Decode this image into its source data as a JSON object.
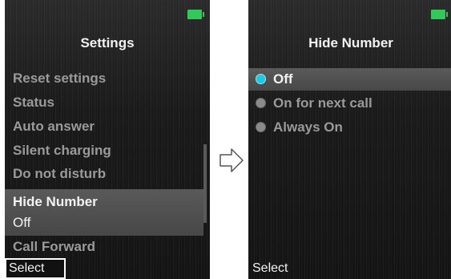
{
  "left_screen": {
    "title": "Settings",
    "menu_items": [
      "Reset settings",
      "Status",
      "Auto answer",
      "Silent charging",
      "Do not disturb",
      "Call Forward"
    ],
    "selected_item": {
      "label": "Hide Number",
      "value": "Off"
    },
    "softkey": "Select"
  },
  "right_screen": {
    "title": "Hide Number",
    "options": [
      {
        "label": "Off",
        "checked": true
      },
      {
        "label": "On for next call",
        "checked": false
      },
      {
        "label": "Always On",
        "checked": false
      }
    ],
    "softkey": "Select"
  },
  "colors": {
    "battery": "#34c759",
    "radio_selected": "#22c7e0",
    "radio_unselected": "#8a8a8a"
  },
  "icons": {
    "battery": "battery-icon",
    "arrow": "right-arrow-icon"
  }
}
